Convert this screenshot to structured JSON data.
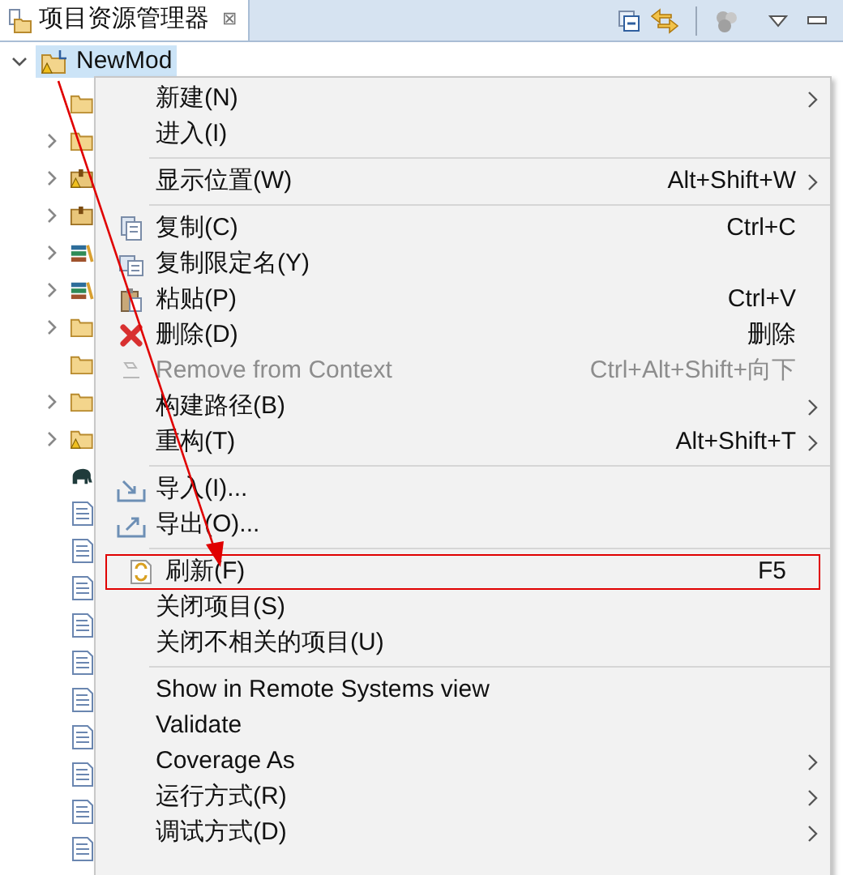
{
  "view": {
    "title": "项目资源管理器",
    "close": "⊠"
  },
  "tree": {
    "root": {
      "label": "NewMod",
      "expanded": true,
      "selected": true
    },
    "children": [
      {
        "kind": "folder",
        "expandable": false
      },
      {
        "kind": "folder",
        "expandable": true
      },
      {
        "kind": "package-warning",
        "expandable": true
      },
      {
        "kind": "package",
        "expandable": true
      },
      {
        "kind": "library",
        "expandable": true
      },
      {
        "kind": "library",
        "expandable": true
      },
      {
        "kind": "folder",
        "expandable": true
      },
      {
        "kind": "folder",
        "expandable": false
      },
      {
        "kind": "folder",
        "expandable": true
      },
      {
        "kind": "folder-warning",
        "expandable": true
      },
      {
        "kind": "elephant",
        "expandable": false
      },
      {
        "kind": "file",
        "expandable": false
      },
      {
        "kind": "file",
        "expandable": false
      },
      {
        "kind": "file",
        "expandable": false
      },
      {
        "kind": "file",
        "expandable": false
      },
      {
        "kind": "file",
        "expandable": false
      },
      {
        "kind": "file",
        "expandable": false
      },
      {
        "kind": "file",
        "expandable": false
      },
      {
        "kind": "file",
        "expandable": false
      },
      {
        "kind": "file",
        "expandable": false
      },
      {
        "kind": "file",
        "expandable": false
      }
    ]
  },
  "context_menu": [
    {
      "kind": "item",
      "label": "新建(N)",
      "submenu": true,
      "disabled": false,
      "marked": false
    },
    {
      "kind": "item",
      "label": "进入(I)",
      "submenu": false,
      "disabled": false,
      "marked": false
    },
    {
      "kind": "separator"
    },
    {
      "kind": "item",
      "label": "显示位置(W)",
      "shortcut": "Alt+Shift+W",
      "submenu": true,
      "disabled": false,
      "marked": false
    },
    {
      "kind": "separator"
    },
    {
      "kind": "item",
      "label": "复制(C)",
      "shortcut": "Ctrl+C",
      "submenu": false,
      "disabled": false,
      "marked": false
    },
    {
      "kind": "item",
      "label": "复制限定名(Y)",
      "submenu": false,
      "disabled": false,
      "marked": false
    },
    {
      "kind": "item",
      "label": "粘贴(P)",
      "shortcut": "Ctrl+V",
      "submenu": false,
      "disabled": false,
      "marked": false
    },
    {
      "kind": "item",
      "label": "删除(D)",
      "shortcut": "删除",
      "submenu": false,
      "disabled": false,
      "marked": false
    },
    {
      "kind": "item",
      "label": "Remove from Context",
      "shortcut": "Ctrl+Alt+Shift+向下",
      "submenu": false,
      "disabled": true,
      "marked": false
    },
    {
      "kind": "item",
      "label": "构建路径(B)",
      "submenu": true,
      "disabled": false,
      "marked": false
    },
    {
      "kind": "item",
      "label": "重构(T)",
      "shortcut": "Alt+Shift+T",
      "submenu": true,
      "disabled": false,
      "marked": false
    },
    {
      "kind": "separator"
    },
    {
      "kind": "item",
      "label": "导入(I)...",
      "submenu": false,
      "disabled": false,
      "marked": false
    },
    {
      "kind": "item",
      "label": "导出(O)...",
      "submenu": false,
      "disabled": false,
      "marked": false
    },
    {
      "kind": "separator"
    },
    {
      "kind": "item",
      "label": "刷新(F)",
      "shortcut": "F5",
      "submenu": false,
      "disabled": false,
      "marked": true
    },
    {
      "kind": "item",
      "label": "关闭项目(S)",
      "submenu": false,
      "disabled": false,
      "marked": false
    },
    {
      "kind": "item",
      "label": "关闭不相关的项目(U)",
      "submenu": false,
      "disabled": false,
      "marked": false
    },
    {
      "kind": "separator"
    },
    {
      "kind": "item",
      "label": "Show in Remote Systems view",
      "submenu": false,
      "disabled": false,
      "marked": false
    },
    {
      "kind": "item",
      "label": "Validate",
      "submenu": false,
      "disabled": false,
      "marked": false
    },
    {
      "kind": "item",
      "label": "Coverage As",
      "submenu": true,
      "disabled": false,
      "marked": false
    },
    {
      "kind": "item",
      "label": "运行方式(R)",
      "submenu": true,
      "disabled": false,
      "marked": false
    },
    {
      "kind": "item",
      "label": "调试方式(D)",
      "submenu": true,
      "disabled": false,
      "marked": false
    }
  ],
  "annotation": {
    "arrow": true
  }
}
